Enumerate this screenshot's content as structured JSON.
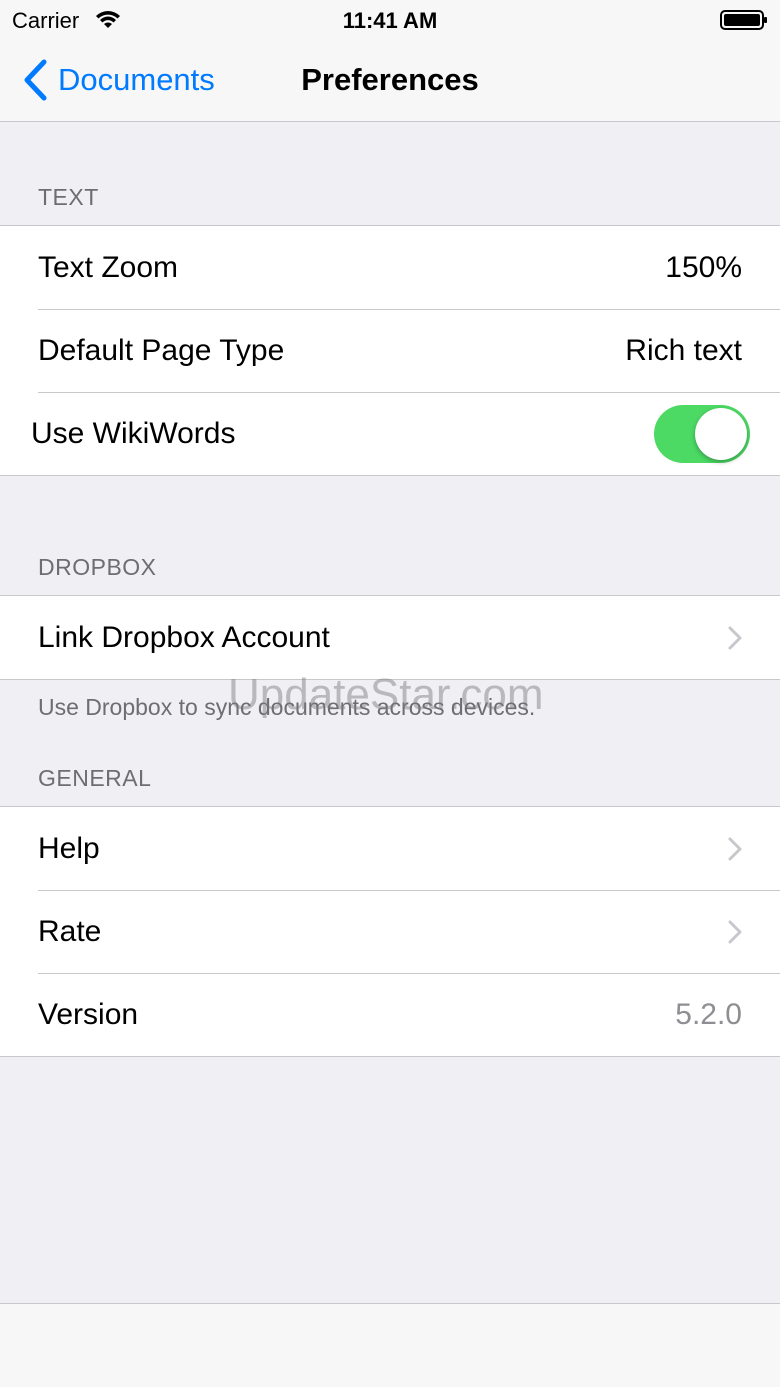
{
  "status_bar": {
    "carrier": "Carrier",
    "time": "11:41 AM"
  },
  "nav": {
    "back_label": "Documents",
    "title": "Preferences",
    "accent_color": "#007aff"
  },
  "sections": {
    "text": {
      "header": "TEXT",
      "text_zoom_label": "Text Zoom",
      "text_zoom_value": "150%",
      "default_page_type_label": "Default Page Type",
      "default_page_type_value": "Rich text",
      "use_wikiwords_label": "Use WikiWords",
      "use_wikiwords_on": true
    },
    "dropbox": {
      "header": "DROPBOX",
      "link_account_label": "Link Dropbox Account",
      "footer": "Use Dropbox to sync documents across devices."
    },
    "general": {
      "header": "GENERAL",
      "help_label": "Help",
      "rate_label": "Rate",
      "version_label": "Version",
      "version_value": "5.2.0"
    }
  },
  "watermark": "UpdateStar.com",
  "colors": {
    "toggle_on": "#4cd964",
    "background": "#efeff4"
  }
}
